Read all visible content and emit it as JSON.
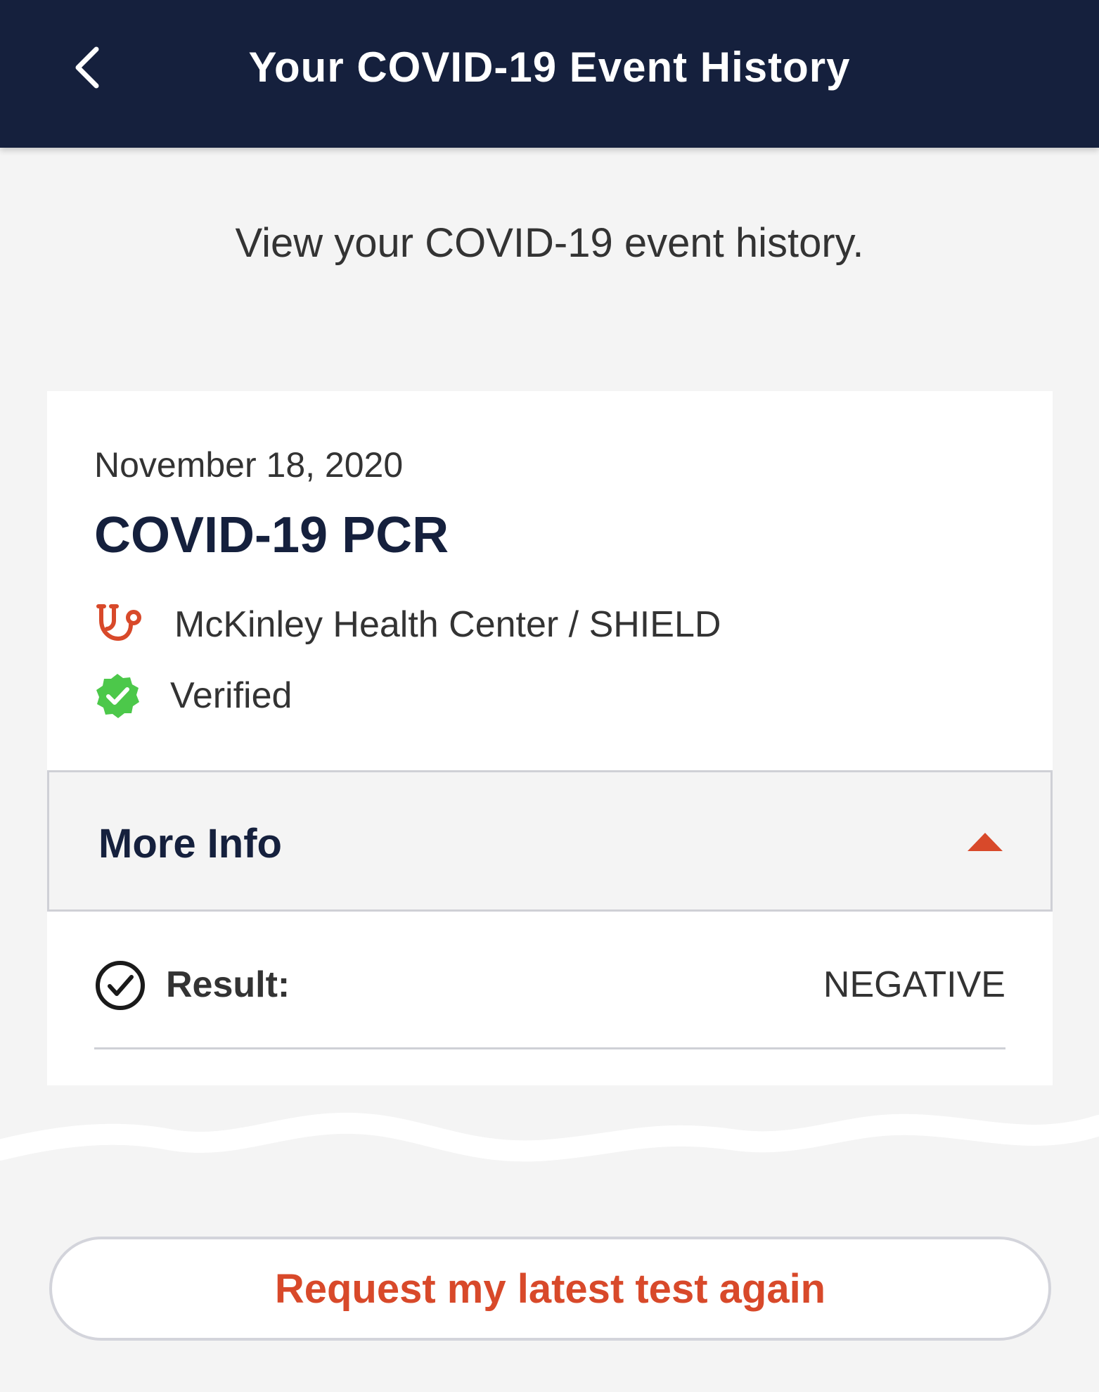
{
  "header": {
    "title": "Your COVID-19 Event History",
    "back_icon": "chevron-left-icon"
  },
  "intro": "View your COVID-19 event history.",
  "event": {
    "date": "November 18, 2020",
    "title": "COVID-19 PCR",
    "provider": "McKinley Health Center / SHIELD",
    "provider_icon": "stethoscope-icon",
    "status": "Verified",
    "status_icon": "verified-badge-icon",
    "more_info_label": "More Info",
    "more_info_icon": "chevron-up-icon",
    "result_label": "Result:",
    "result_value": "NEGATIVE",
    "result_icon": "check-circle-icon"
  },
  "actions": {
    "request_label": "Request my latest test again"
  },
  "colors": {
    "header_bg": "#15203d",
    "accent": "#d8492a",
    "verified": "#4cc84a",
    "page_bg": "#f4f4f4"
  }
}
